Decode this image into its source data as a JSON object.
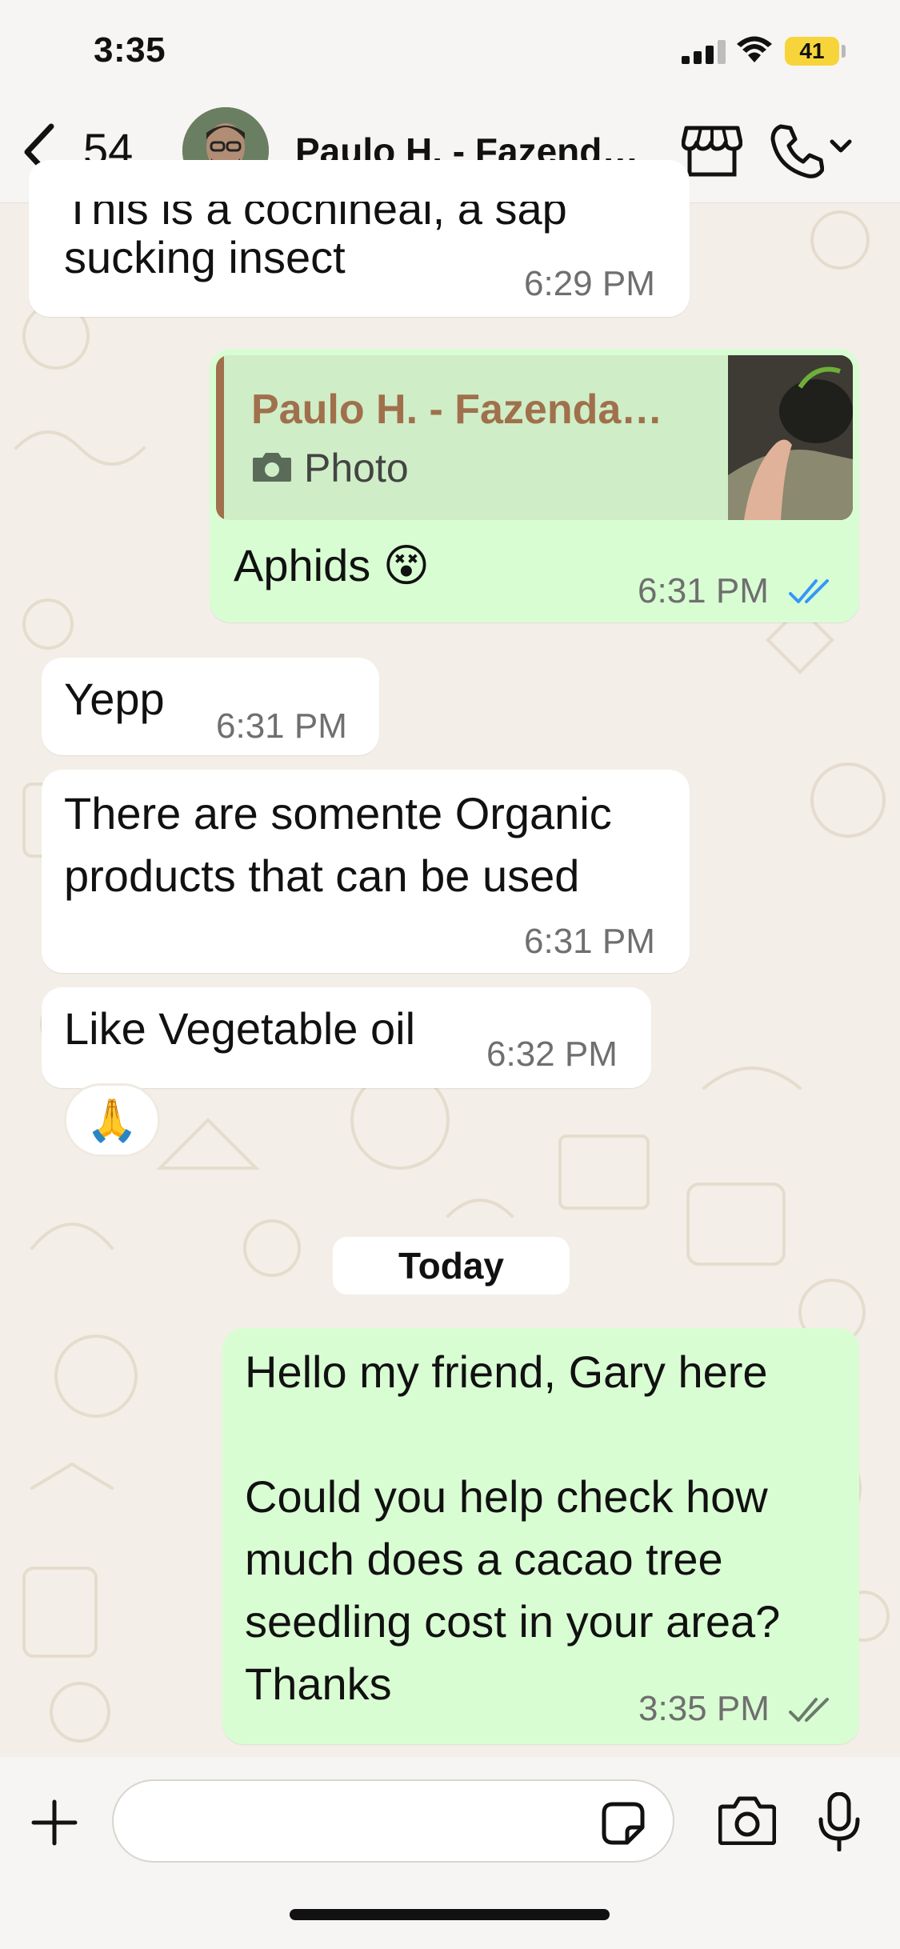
{
  "status_bar": {
    "time": "3:35",
    "battery": "41"
  },
  "header": {
    "back_count": "54",
    "contact_name": "Paulo H. - Fazend…"
  },
  "messages": [
    {
      "direction": "in",
      "text": "sucking insect",
      "partial_text_above": "This is a cochineal, a sap",
      "time": "6:29 PM"
    },
    {
      "direction": "out",
      "quote_name": "Paulo H. - Fazenda…",
      "quote_type": "Photo",
      "text": "Aphids 😵",
      "time": "6:31 PM",
      "status": "read"
    },
    {
      "direction": "in",
      "text": "Yepp",
      "time": "6:31 PM"
    },
    {
      "direction": "in",
      "text": "There are somente Organic\nproducts that can be used",
      "time": "6:31 PM"
    },
    {
      "direction": "in",
      "text": "Like Vegetable oil",
      "time": "6:32 PM",
      "reaction": "🙏"
    },
    {
      "direction": "out",
      "text": "Hello my friend, Gary here\n\nCould you help check how\nmuch does a cacao tree\nseedling cost in your area?\nThanks",
      "time": "3:35 PM",
      "status": "delivered"
    }
  ],
  "date_separator": "Today",
  "input": {
    "placeholder": ""
  },
  "colors": {
    "outgoing_bubble": "#d9fdd3",
    "incoming_bubble": "#ffffff",
    "read_tick": "#3497f9",
    "quote_accent": "#a0704c",
    "battery": "#f7d53a"
  },
  "icons": [
    "back-icon",
    "store-icon",
    "phone-icon",
    "camera-icon",
    "plus-icon",
    "sticker-icon",
    "microphone-icon",
    "double-check-icon"
  ]
}
